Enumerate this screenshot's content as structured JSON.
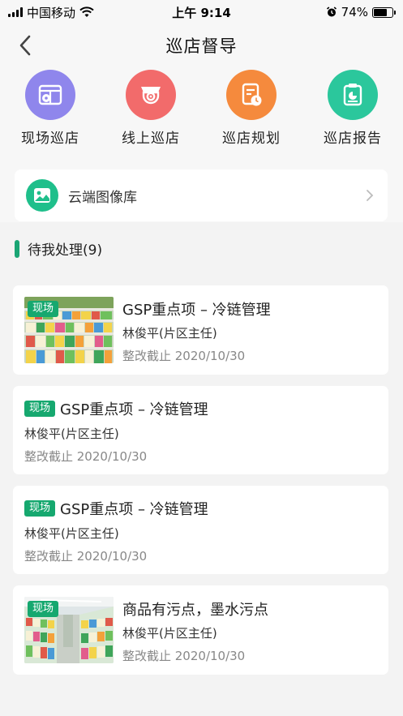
{
  "status_bar": {
    "carrier": "中国移动",
    "time": "上午 9:14",
    "battery": "74%",
    "battery_level": 0.74
  },
  "header": {
    "title": "巡店督导"
  },
  "quick_actions": [
    {
      "label": "现场巡店",
      "icon": "store-map-icon",
      "color": "#8f86ec"
    },
    {
      "label": "线上巡店",
      "icon": "camera-icon",
      "color": "#f26b6b"
    },
    {
      "label": "巡店规划",
      "icon": "schedule-icon",
      "color": "#f58a3d"
    },
    {
      "label": "巡店报告",
      "icon": "report-icon",
      "color": "#2bc79c"
    }
  ],
  "cloud_library": {
    "label": "云端图像库",
    "icon": "image-icon"
  },
  "section": {
    "title": "待我处理(9)"
  },
  "tasks": [
    {
      "tag": "现场",
      "title": "GSP重点项 – 冷链管理",
      "assignee": "林俊平(片区主任)",
      "deadline": "整改截止 2020/10/30"
    },
    {
      "tag": "现场",
      "title": "GSP重点项 – 冷链管理",
      "assignee": "林俊平(片区主任)",
      "deadline": "整改截止 2020/10/30"
    },
    {
      "tag": "现场",
      "title": "GSP重点项 – 冷链管理",
      "assignee": "林俊平(片区主任)",
      "deadline": "整改截止 2020/10/30"
    },
    {
      "tag": "现场",
      "title": "商品有污点，墨水污点",
      "assignee": "林俊平(片区主任)",
      "deadline": "整改截止 2020/10/30"
    }
  ],
  "colors": {
    "accent": "#16a86f",
    "section_bar": "#1aa574"
  }
}
